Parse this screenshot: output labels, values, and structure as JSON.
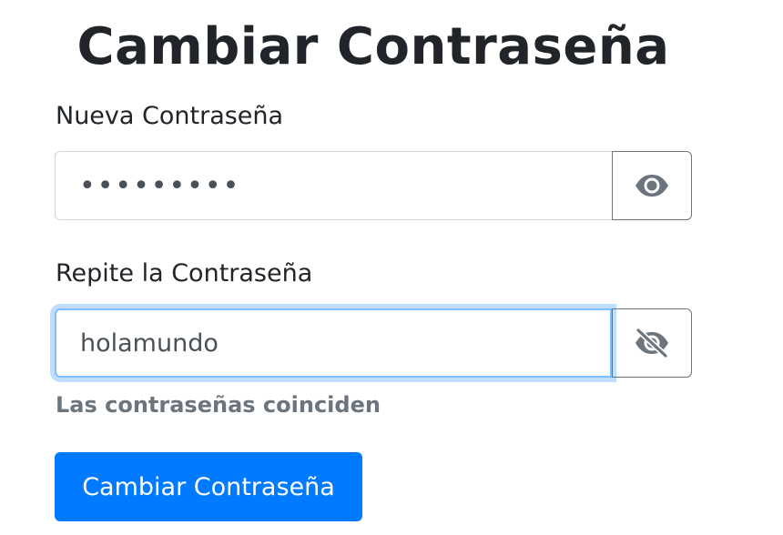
{
  "page": {
    "title": "Cambiar Contraseña"
  },
  "form": {
    "new_password": {
      "label": "Nueva Contraseña",
      "value": "•••••••••",
      "toggle_icon": "eye-icon"
    },
    "repeat_password": {
      "label": "Repite la Contraseña",
      "value": "holamundo",
      "toggle_icon": "eye-slash-icon"
    },
    "match_message": "Las contraseñas coinciden",
    "submit_label": "Cambiar Contraseña"
  },
  "colors": {
    "primary": "#007bff",
    "muted": "#6c757d",
    "focus_border": "#80bdff",
    "text": "#212529"
  }
}
